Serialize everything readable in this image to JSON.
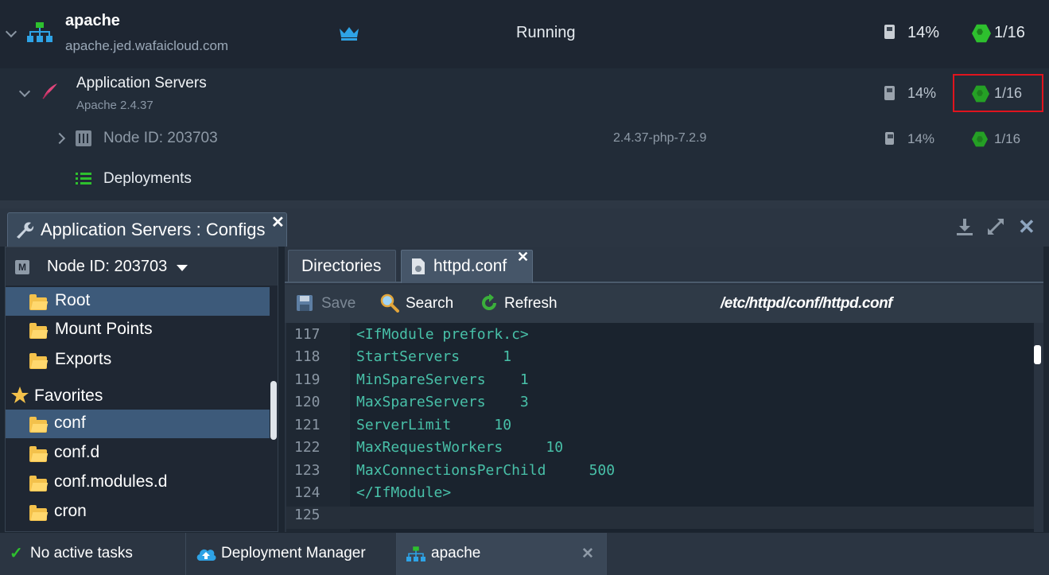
{
  "environment": {
    "name": "apache",
    "domain": "apache.jed.wafaicloud.com",
    "status": "Running",
    "disk": "14%",
    "cloudlets": "1/16"
  },
  "app_servers": {
    "label": "Application Servers",
    "version": "Apache 2.4.37",
    "disk": "14%",
    "cloudlets": "1/16"
  },
  "node": {
    "label": "Node ID: 203703",
    "tag": "2.4.37-php-7.2.9",
    "disk": "14%",
    "cloudlets": "1/16"
  },
  "deployments_label": "Deployments",
  "panel": {
    "tab_title": "Application Servers : Configs",
    "node_selector": "Node ID: 203703",
    "node_badge": "M"
  },
  "tree": {
    "root": "Root",
    "mount_points": "Mount Points",
    "exports": "Exports",
    "favorites": "Favorites",
    "items": [
      "conf",
      "conf.d",
      "conf.modules.d",
      "cron"
    ]
  },
  "editor": {
    "tabs": [
      "Directories",
      "httpd.conf"
    ],
    "toolbar": {
      "save": "Save",
      "search": "Search",
      "refresh": "Refresh"
    },
    "path": "/etc/httpd/conf/httpd.conf",
    "lines": [
      {
        "n": "117",
        "t": "<IfModule prefork.c>"
      },
      {
        "n": "118",
        "t": "StartServers     1"
      },
      {
        "n": "119",
        "t": "MinSpareServers    1"
      },
      {
        "n": "120",
        "t": "MaxSpareServers    3"
      },
      {
        "n": "121",
        "t": "ServerLimit     10"
      },
      {
        "n": "122",
        "t": "MaxRequestWorkers     10"
      },
      {
        "n": "123",
        "t": "MaxConnectionsPerChild     500"
      },
      {
        "n": "124",
        "t": "</IfModule>"
      },
      {
        "n": "125",
        "t": ""
      }
    ]
  },
  "statusbar": {
    "tasks": "No active tasks",
    "deployment_manager": "Deployment Manager",
    "env_tab": "apache"
  },
  "colors": {
    "accent_green": "#2ec02e",
    "highlight_red": "#e0141e",
    "code_text": "#48c0a8"
  }
}
